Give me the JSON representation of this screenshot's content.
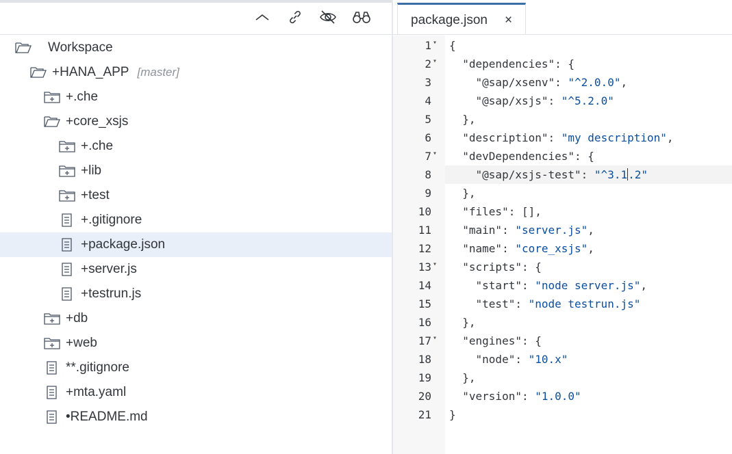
{
  "toolbar": {
    "icons": [
      "chevron-up-icon",
      "link-icon",
      "eye-slash-icon",
      "binoculars-icon"
    ]
  },
  "explorer": {
    "rows": [
      {
        "name": "Workspace",
        "status": "",
        "branch": "",
        "type": "folder-open"
      },
      {
        "name": "HANA_APP",
        "status": "+",
        "branch": "[master]",
        "type": "folder-open"
      },
      {
        "name": ".che",
        "status": "+",
        "branch": "",
        "type": "folder-closed"
      },
      {
        "name": "core_xsjs",
        "status": "+",
        "branch": "",
        "type": "folder-open"
      },
      {
        "name": ".che",
        "status": "+",
        "branch": "",
        "type": "folder-closed"
      },
      {
        "name": "lib",
        "status": "+",
        "branch": "",
        "type": "folder-closed"
      },
      {
        "name": "test",
        "status": "+",
        "branch": "",
        "type": "folder-closed"
      },
      {
        "name": ".gitignore",
        "status": "+",
        "branch": "",
        "type": "file"
      },
      {
        "name": "package.json",
        "status": "+",
        "branch": "",
        "type": "file",
        "selected": true
      },
      {
        "name": "server.js",
        "status": "+",
        "branch": "",
        "type": "file"
      },
      {
        "name": "testrun.js",
        "status": "+",
        "branch": "",
        "type": "file"
      },
      {
        "name": "db",
        "status": "+",
        "branch": "",
        "type": "folder-closed"
      },
      {
        "name": "web",
        "status": "+",
        "branch": "",
        "type": "folder-closed"
      },
      {
        "name": ".gitignore",
        "status": "**",
        "branch": "",
        "type": "file"
      },
      {
        "name": "mta.yaml",
        "status": "+",
        "branch": "",
        "type": "file"
      },
      {
        "name": "README.md",
        "status": "•",
        "branch": "",
        "type": "file"
      }
    ]
  },
  "editor": {
    "tab": {
      "title": "package.json",
      "close": "×"
    },
    "lines": [
      "{",
      "  \"dependencies\": {",
      "    \"@sap/xsenv\": \"^2.0.0\",",
      "    \"@sap/xsjs\": \"^5.2.0\"",
      "  },",
      "  \"description\": \"my description\",",
      "  \"devDependencies\": {",
      "    \"@sap/xsjs-test\": \"^3.1.2\"",
      "  },",
      "  \"files\": [],",
      "  \"main\": \"server.js\",",
      "  \"name\": \"core_xsjs\",",
      "  \"scripts\": {",
      "    \"start\": \"node server.js\",",
      "    \"test\": \"node testrun.js\"",
      "  },",
      "  \"engines\": {",
      "    \"node\": \"10.x\"",
      "  },",
      "  \"version\": \"1.0.0\"",
      "}"
    ],
    "line_numbers": [
      "1",
      "2",
      "3",
      "4",
      "5",
      "6",
      "7",
      "8",
      "9",
      "10",
      "11",
      "12",
      "13",
      "14",
      "15",
      "16",
      "17",
      "18",
      "19",
      "20",
      "21"
    ],
    "foldable_lines": [
      1,
      2,
      7,
      13,
      17
    ],
    "active_line": 8,
    "colors": {
      "string": "#0a4ea0",
      "key": "#32363a",
      "tab_accent": "#3a6ea5"
    }
  }
}
